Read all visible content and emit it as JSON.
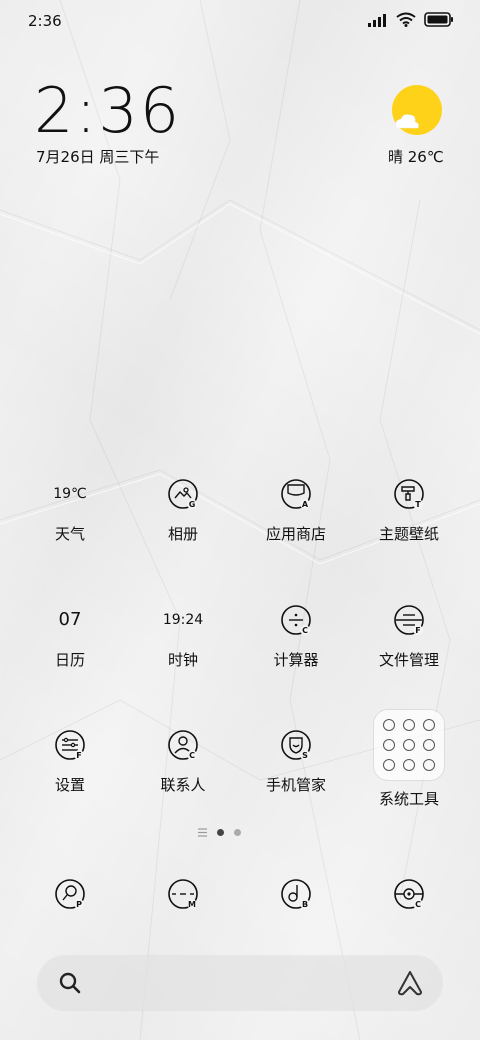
{
  "status_bar": {
    "time": "2:36",
    "icons": [
      "signal-icon",
      "wifi-icon",
      "battery-icon"
    ]
  },
  "clock_widget": {
    "time": "2:36",
    "date": "7月26日 周三下午"
  },
  "weather_widget": {
    "icon": "sun-cloud-icon",
    "text": "晴 26℃",
    "sun_color": "#ffd21a"
  },
  "apps": [
    {
      "label": "天气",
      "icon_text": "19℃",
      "icon": "weather-icon"
    },
    {
      "label": "相册",
      "icon": "gallery-icon",
      "icon_letter": "G"
    },
    {
      "label": "应用商店",
      "icon": "app-store-icon",
      "icon_letter": "A"
    },
    {
      "label": "主题壁纸",
      "icon": "themes-icon",
      "icon_letter": "T"
    },
    {
      "label": "日历",
      "icon_text": "07",
      "icon": "calendar-icon"
    },
    {
      "label": "时钟",
      "icon_text": "19:24",
      "icon": "clock-icon"
    },
    {
      "label": "计算器",
      "icon": "calculator-icon",
      "icon_letter": "C"
    },
    {
      "label": "文件管理",
      "icon": "file-manager-icon",
      "icon_letter": "F"
    },
    {
      "label": "设置",
      "icon": "settings-icon",
      "icon_letter": "F"
    },
    {
      "label": "联系人",
      "icon": "contacts-icon",
      "icon_letter": "C"
    },
    {
      "label": "手机管家",
      "icon": "security-icon",
      "icon_letter": "S"
    },
    {
      "label": "系统工具",
      "icon": "folder-icon"
    }
  ],
  "page_indicator": {
    "pages": 2,
    "current": 1
  },
  "dock": [
    {
      "icon": "phone-icon",
      "icon_letter": "P"
    },
    {
      "icon": "messages-icon",
      "icon_letter": "M"
    },
    {
      "icon": "browser-icon",
      "icon_letter": "B"
    },
    {
      "icon": "camera-icon",
      "icon_letter": "C"
    }
  ],
  "search_bar": {
    "left_icon": "search-icon",
    "right_icon": "assistant-icon"
  }
}
